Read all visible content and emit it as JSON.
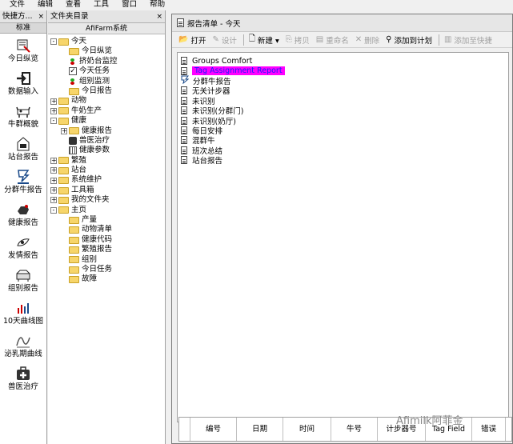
{
  "menu": [
    "文件",
    "编辑",
    "查看",
    "工具",
    "窗口",
    "帮助"
  ],
  "shortcut": {
    "title": "快捷方...",
    "close": "×",
    "header": "标准",
    "items": [
      "今日纵览",
      "数据输入",
      "牛群概貌",
      "站台报告",
      "分群牛报告",
      "健康报告",
      "发情报告",
      "组别报告",
      "10天曲线图",
      "泌乳期曲线",
      "兽医治疗"
    ]
  },
  "folder": {
    "title": "文件夹目录",
    "close": "×",
    "header": "AfiFarm系统",
    "tree": [
      {
        "label": "今天",
        "indent": 0,
        "exp": "-",
        "icon": "folder"
      },
      {
        "label": "今日纵览",
        "indent": 1,
        "icon": "folder"
      },
      {
        "label": "挤奶台监控",
        "indent": 1,
        "icon": "traffic"
      },
      {
        "label": "今天任务",
        "indent": 1,
        "icon": "tick"
      },
      {
        "label": "组别监测",
        "indent": 1,
        "icon": "traffic"
      },
      {
        "label": "今日报告",
        "indent": 1,
        "icon": "folder"
      },
      {
        "label": "动物",
        "indent": 0,
        "exp": "+",
        "icon": "folder"
      },
      {
        "label": "牛奶生产",
        "indent": 0,
        "exp": "+",
        "icon": "folder"
      },
      {
        "label": "健康",
        "indent": 0,
        "exp": "-",
        "icon": "folder"
      },
      {
        "label": "健康报告",
        "indent": 1,
        "exp": "+",
        "icon": "folder"
      },
      {
        "label": "兽医治疗",
        "indent": 1,
        "icon": "lock"
      },
      {
        "label": "健康参数",
        "indent": 1,
        "icon": "grid"
      },
      {
        "label": "繁殖",
        "indent": 0,
        "exp": "+",
        "icon": "folder"
      },
      {
        "label": "站台",
        "indent": 0,
        "exp": "+",
        "icon": "folder"
      },
      {
        "label": "系统维护",
        "indent": 0,
        "exp": "+",
        "icon": "folder"
      },
      {
        "label": "工具箱",
        "indent": 0,
        "exp": "+",
        "icon": "folder"
      },
      {
        "label": "我的文件夹",
        "indent": 0,
        "exp": "+",
        "icon": "folder"
      },
      {
        "label": "主页",
        "indent": 0,
        "exp": "-",
        "icon": "folder"
      },
      {
        "label": "产量",
        "indent": 1,
        "icon": "folder"
      },
      {
        "label": "动物清单",
        "indent": 1,
        "icon": "folder"
      },
      {
        "label": "健康代码",
        "indent": 1,
        "icon": "folder"
      },
      {
        "label": "繁殖报告",
        "indent": 1,
        "icon": "folder"
      },
      {
        "label": "组别",
        "indent": 1,
        "icon": "folder"
      },
      {
        "label": "今日任务",
        "indent": 1,
        "icon": "folder"
      },
      {
        "label": "故障",
        "indent": 1,
        "icon": "folder"
      }
    ]
  },
  "report": {
    "title": "报告清单 - 今天",
    "toolbar": [
      {
        "label": "打开",
        "icon": "📂",
        "disabled": false
      },
      {
        "label": "设计",
        "icon": "✎",
        "disabled": true
      },
      {
        "sep": true
      },
      {
        "label": "新建 ▾",
        "icon": "🗋",
        "disabled": false
      },
      {
        "label": "拷贝",
        "icon": "⎘",
        "disabled": true
      },
      {
        "label": "重命名",
        "icon": "▤",
        "disabled": true
      },
      {
        "label": "删除",
        "icon": "✕",
        "disabled": true
      },
      {
        "label": "添加到计划",
        "icon": "⚲",
        "disabled": false
      },
      {
        "sep": true
      },
      {
        "label": "添加至快捷",
        "icon": "▥",
        "disabled": true
      }
    ],
    "items": [
      {
        "label": "Groups Comfort",
        "selected": false
      },
      {
        "label": "Tag Assignment Report",
        "selected": true
      },
      {
        "label": "分群牛报告",
        "selected": false,
        "icon": "cow"
      },
      {
        "label": "无关计步器",
        "selected": false
      },
      {
        "label": "未识别",
        "selected": false
      },
      {
        "label": "未识别(分群门)",
        "selected": false
      },
      {
        "label": "未识别(奶厅)",
        "selected": false
      },
      {
        "label": "每日安排",
        "selected": false
      },
      {
        "label": "混群牛",
        "selected": false
      },
      {
        "label": "班次总结",
        "selected": false
      },
      {
        "label": "站台报告",
        "selected": false
      }
    ],
    "columns": [
      "编号",
      "日期",
      "时间",
      "牛号",
      "计步器号",
      "Tag Field",
      "错误"
    ]
  },
  "watermark": "Afimilk阿菲金"
}
